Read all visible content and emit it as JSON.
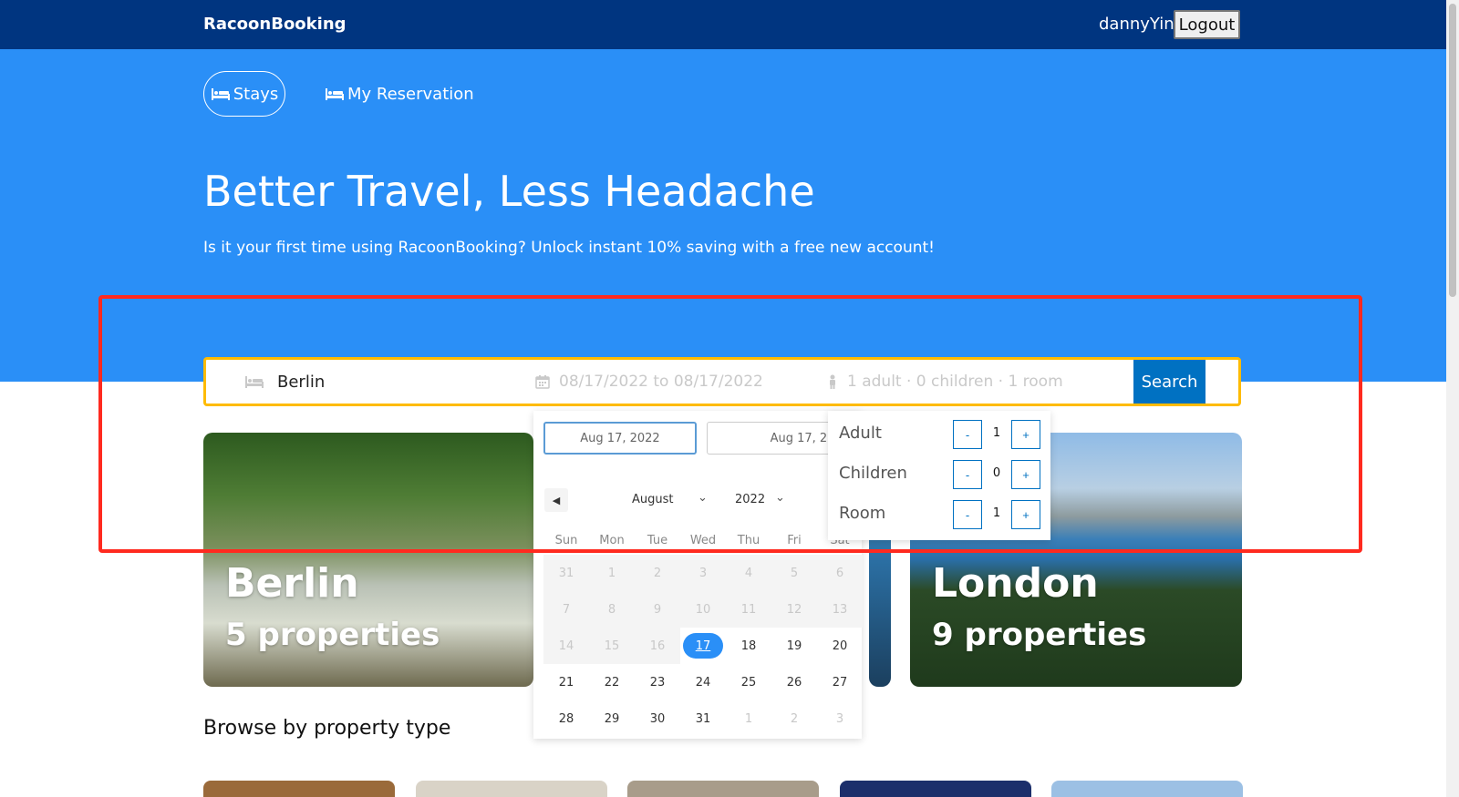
{
  "header": {
    "brand": "RacoonBooking",
    "username": "dannyYin",
    "logout_label": "Logout"
  },
  "nav": {
    "tabs": [
      {
        "label": "Stays",
        "icon": "bed-icon"
      },
      {
        "label": "My Reservation",
        "icon": "bed-icon"
      }
    ]
  },
  "hero": {
    "title": "Better Travel, Less Headache",
    "subtitle": "Is it your first time using RacoonBooking? Unlock instant 10% saving with a free new account!"
  },
  "search": {
    "destination": "Berlin",
    "date_range": "08/17/2022 to 08/17/2022",
    "guests": "1 adult · 0 children · 1 room",
    "search_label": "Search"
  },
  "cards": [
    {
      "city": "Berlin",
      "count": "5 properties"
    },
    {
      "city": "London",
      "count": "9 properties"
    }
  ],
  "datepicker": {
    "start_input": "Aug 17, 2022",
    "end_input": "Aug 17, 2022",
    "month": "August",
    "year": "2022",
    "weekdays": [
      "Sun",
      "Mon",
      "Tue",
      "Wed",
      "Thu",
      "Fri",
      "Sat"
    ],
    "days": [
      "31",
      "1",
      "2",
      "3",
      "4",
      "5",
      "6",
      "7",
      "8",
      "9",
      "10",
      "11",
      "12",
      "13",
      "14",
      "15",
      "16",
      "17",
      "18",
      "19",
      "20",
      "21",
      "22",
      "23",
      "24",
      "25",
      "26",
      "27",
      "28",
      "29",
      "30",
      "31",
      "1",
      "2",
      "3"
    ],
    "selected": "17"
  },
  "guest_panel": {
    "rows": [
      {
        "label": "Adult",
        "value": "1"
      },
      {
        "label": "Children",
        "value": "0"
      },
      {
        "label": "Room",
        "value": "1"
      }
    ],
    "minus_label": "-",
    "plus_label": "+"
  },
  "browse": {
    "title": "Browse by property type"
  },
  "colors": {
    "topbar": "#003580",
    "hero": "#2a8ff7",
    "search_border": "#febb02",
    "search_button": "#0071c2",
    "highlight": "#ff2a1f"
  }
}
